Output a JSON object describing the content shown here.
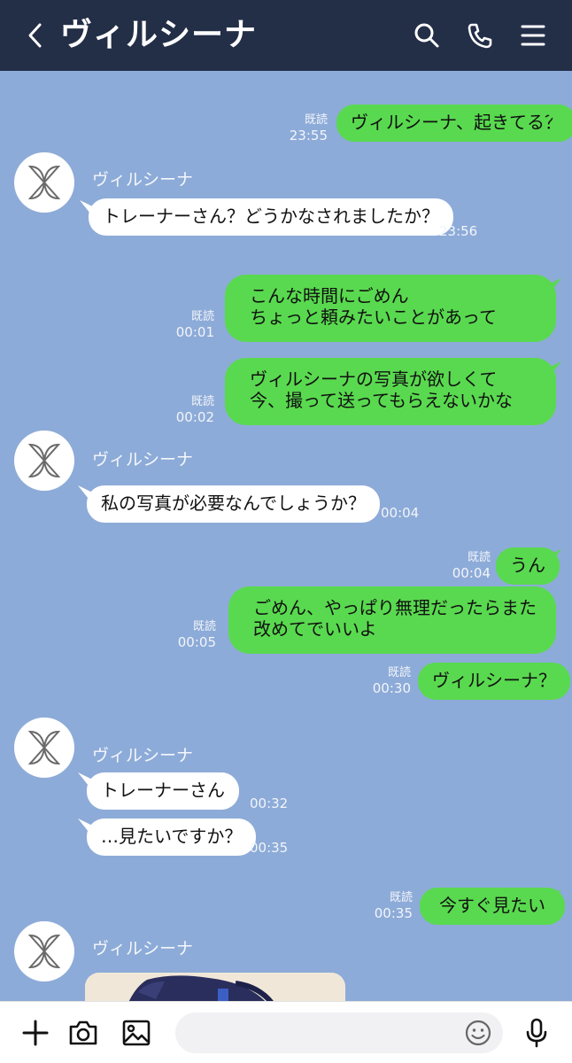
{
  "header": {
    "title": "ヴィルシーナ",
    "icons": [
      "back-icon",
      "search-icon",
      "phone-icon",
      "menu-icon"
    ]
  },
  "messages": [
    {
      "dir": "out",
      "text": "ヴィルシーナ、起きてる？",
      "read": "既読",
      "time": "23:55"
    },
    {
      "dir": "in",
      "sender": "ヴィルシーナ",
      "text": "トレーナーさん？どうかなされましたか？",
      "time": "23:56"
    },
    {
      "dir": "out",
      "lines": [
        "こんな時間にごめん",
        "ちょっと頼みたいことがあって"
      ],
      "read": "既読",
      "time": "00:01"
    },
    {
      "dir": "out",
      "lines": [
        "ヴィルシーナの写真が欲しくて",
        "今、撮って送ってもらえないかな"
      ],
      "read": "既読",
      "time": "00:02"
    },
    {
      "dir": "in",
      "sender": "ヴィルシーナ",
      "text": "私の写真が必要なんでしょうか？",
      "time": "00:04"
    },
    {
      "dir": "out",
      "text": "うん",
      "read": "既読",
      "time": "00:04"
    },
    {
      "dir": "out",
      "lines": [
        "ごめん、やっぱり無理だったらまた",
        "改めてでいいよ"
      ],
      "read": "既読",
      "time": "00:05"
    },
    {
      "dir": "out",
      "text": "ヴィルシーナ？",
      "read": "既読",
      "time": "00:30"
    },
    {
      "dir": "in",
      "sender": "ヴィルシーナ",
      "text": "トレーナーさん",
      "time": "00:32"
    },
    {
      "dir": "in",
      "text": "…見たいですか？",
      "time": "00:35"
    },
    {
      "dir": "out",
      "text": "今すぐ見たい",
      "read": "既読",
      "time": "00:35"
    },
    {
      "dir": "in",
      "sender": "ヴィルシーナ",
      "type": "image"
    }
  ],
  "bottom_bar": {
    "icons": [
      "plus-icon",
      "camera-icon",
      "image-icon",
      "emoji-icon",
      "microphone-icon"
    ],
    "input_placeholder": ""
  },
  "colors": {
    "header_bg": "#232e47",
    "chat_bg": "#8dabd8",
    "outgoing_bubble": "#59d94f",
    "incoming_bubble": "#ffffff"
  }
}
